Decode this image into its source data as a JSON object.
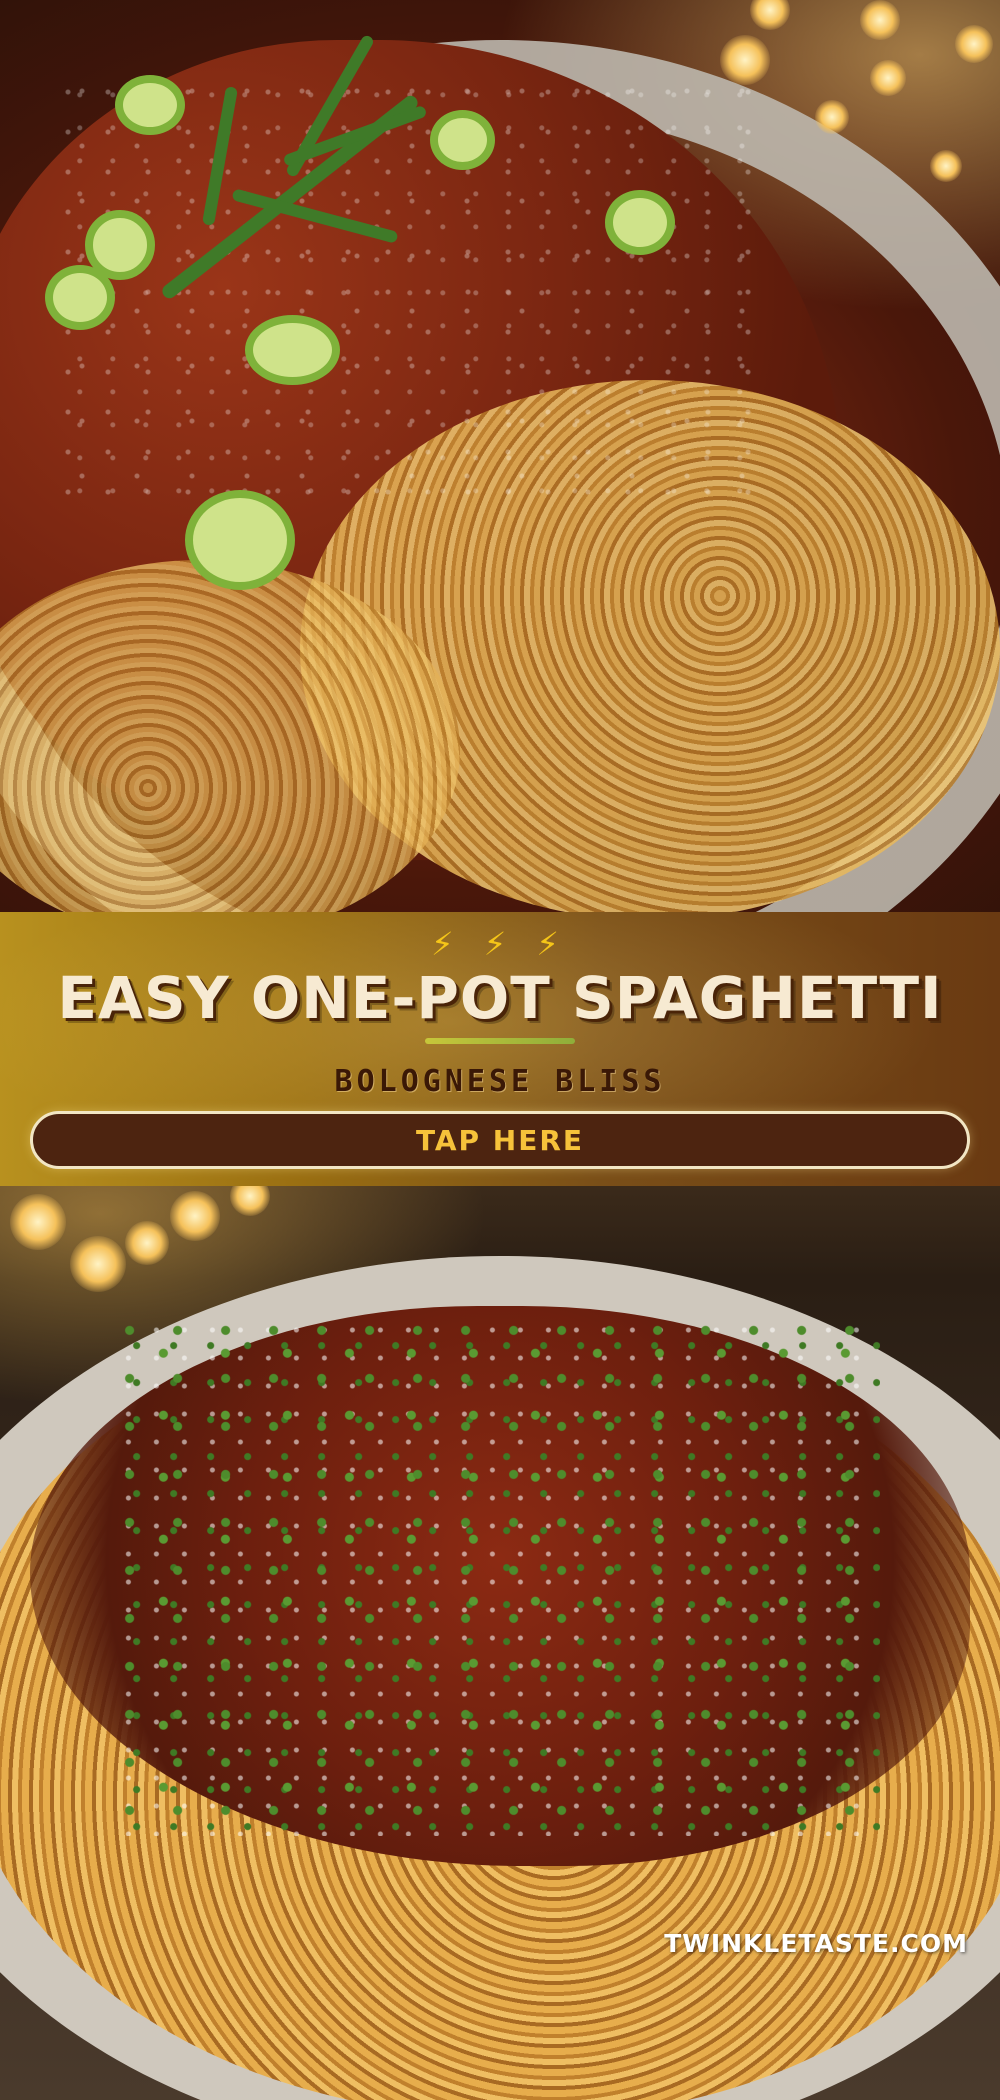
{
  "banner": {
    "decor": "⚡ ⚡ ⚡",
    "title": "EASY ONE-POT SPAGHETTI",
    "subtitle": "BOLOGNESE BLISS",
    "cta_label": "TAP HERE"
  },
  "watermark": "TWINKLETASTE.COM",
  "images": {
    "top": "spaghetti-bolognese-with-rosemary-and-scallions",
    "bottom": "spaghetti-bolognese-with-parsley-and-parmesan"
  },
  "colors": {
    "banner_start": "#b8911f",
    "banner_end": "#6a3a12",
    "title": "#f7ead2",
    "cta_bg": "#4d2410",
    "cta_text": "#f6c23a"
  }
}
